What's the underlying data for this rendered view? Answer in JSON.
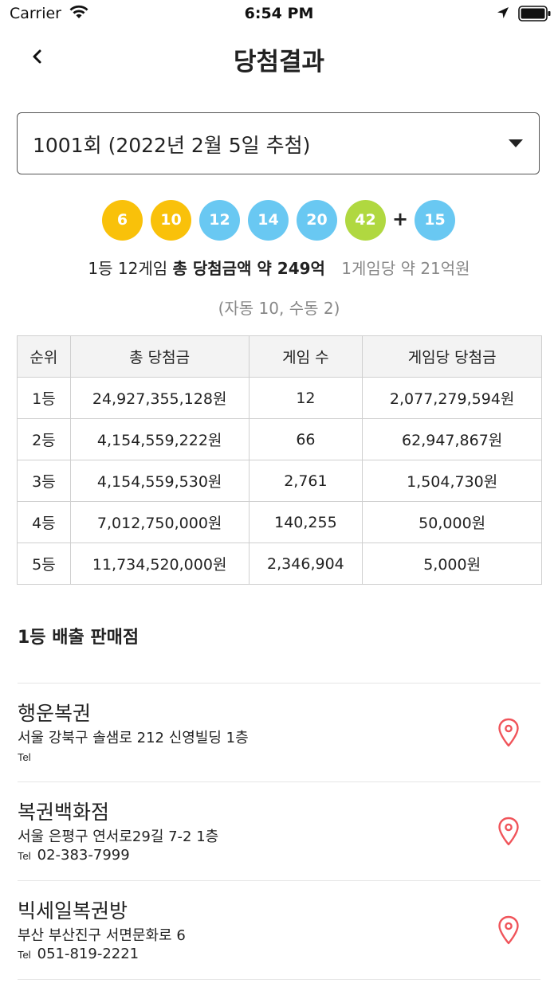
{
  "status_bar": {
    "carrier": "Carrier",
    "time": "6:54 PM"
  },
  "nav": {
    "title": "당첨결과"
  },
  "round_select": {
    "value": "1001회 (2022년 2월 5일 추첨)"
  },
  "numbers": [
    {
      "value": "6",
      "color": "#f9c10a"
    },
    {
      "value": "10",
      "color": "#f9c10a"
    },
    {
      "value": "12",
      "color": "#69c8f2"
    },
    {
      "value": "14",
      "color": "#69c8f2"
    },
    {
      "value": "20",
      "color": "#69c8f2"
    },
    {
      "value": "42",
      "color": "#b0d840"
    }
  ],
  "plus": "+",
  "bonus": {
    "value": "15",
    "color": "#69c8f2"
  },
  "summary": {
    "games": "1등 12게임",
    "total": "총 당첨금액 약 249억",
    "per_game": "1게임당 약 21억원",
    "auto_manual": "(자동 10, 수동 2)"
  },
  "table": {
    "headers": [
      "순위",
      "총 당첨금",
      "게임 수",
      "게임당 당첨금"
    ],
    "rows": [
      [
        "1등",
        "24,927,355,128원",
        "12",
        "2,077,279,594원"
      ],
      [
        "2등",
        "4,154,559,222원",
        "66",
        "62,947,867원"
      ],
      [
        "3등",
        "4,154,559,530원",
        "2,761",
        "1,504,730원"
      ],
      [
        "4등",
        "7,012,750,000원",
        "140,255",
        "50,000원"
      ],
      [
        "5등",
        "11,734,520,000원",
        "2,346,904",
        "5,000원"
      ]
    ]
  },
  "stores_section": {
    "title": "1등 배출 판매점"
  },
  "stores": [
    {
      "name": "행운복권",
      "address": "서울 강북구 솔샘로 212 신영빌딩 1층",
      "tel_label": "Tel",
      "tel": ""
    },
    {
      "name": "복권백화점",
      "address": "서울 은평구 연서로29길 7-2 1층",
      "tel_label": "Tel",
      "tel": "02-383-7999"
    },
    {
      "name": "빅세일복권방",
      "address": "부산 부산진구 서면문화로 6",
      "tel_label": "Tel",
      "tel": "051-819-2221"
    }
  ],
  "colors": {
    "pin": "#f0545a",
    "accent_yellow": "#f9c10a",
    "accent_blue": "#69c8f2",
    "accent_green": "#b0d840"
  },
  "icons": {
    "back": "chevron-left-icon",
    "pin": "map-pin-icon",
    "caret": "caret-down-icon"
  }
}
